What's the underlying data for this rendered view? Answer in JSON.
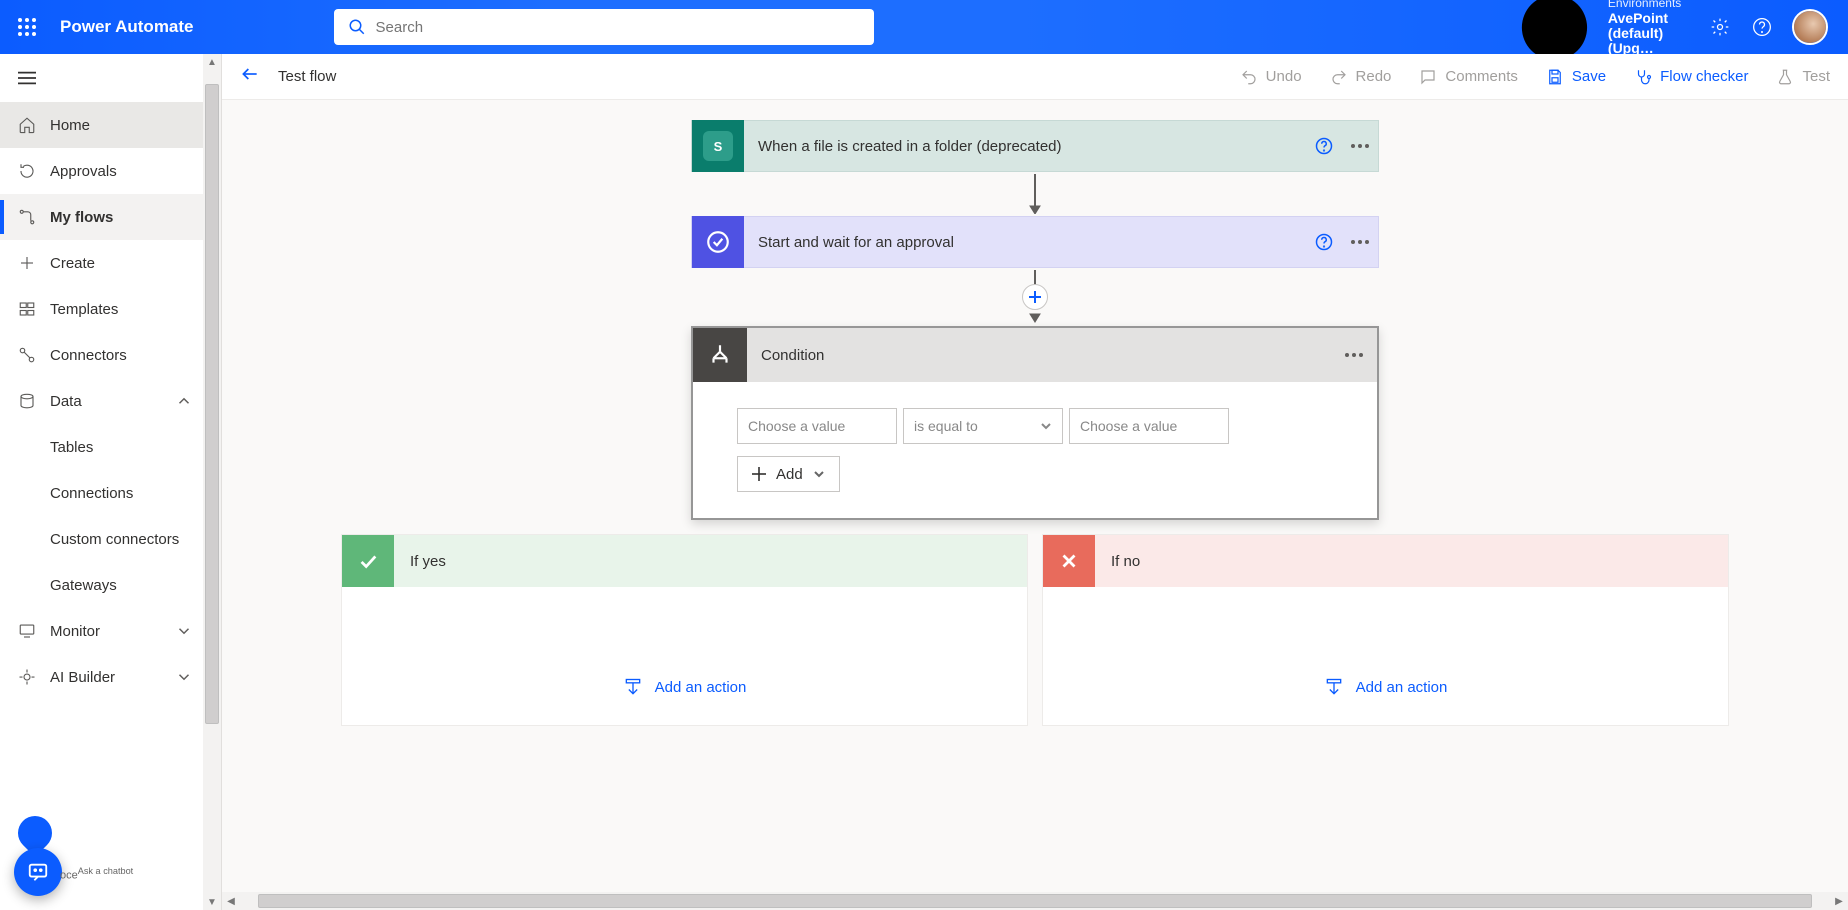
{
  "brand": "Power Automate",
  "search": {
    "placeholder": "Search"
  },
  "env": {
    "label": "Environments",
    "value": "AvePoint (default) (Upg…"
  },
  "sidebar": {
    "items": [
      {
        "label": "Home"
      },
      {
        "label": "Approvals"
      },
      {
        "label": "My flows"
      },
      {
        "label": "Create"
      },
      {
        "label": "Templates"
      },
      {
        "label": "Connectors"
      },
      {
        "label": "Data"
      },
      {
        "label": "Monitor"
      },
      {
        "label": "AI Builder"
      }
    ],
    "data_children": [
      {
        "label": "Tables"
      },
      {
        "label": "Connections"
      },
      {
        "label": "Custom connectors"
      },
      {
        "label": "Gateways"
      }
    ],
    "chatbot_hint_prefix": "oce",
    "chatbot_hint": "Ask a chatbot"
  },
  "cmd": {
    "flow_title": "Test flow",
    "undo": "Undo",
    "redo": "Redo",
    "comments": "Comments",
    "save": "Save",
    "checker": "Flow checker",
    "test": "Test"
  },
  "steps": {
    "trigger": "When a file is created in a folder (deprecated)",
    "approval": "Start and wait for an approval",
    "condition": "Condition"
  },
  "condition": {
    "left_placeholder": "Choose a value",
    "operator": "is equal to",
    "right_placeholder": "Choose a value",
    "add": "Add"
  },
  "branches": {
    "yes": "If yes",
    "no": "If no",
    "add_action": "Add an action"
  }
}
